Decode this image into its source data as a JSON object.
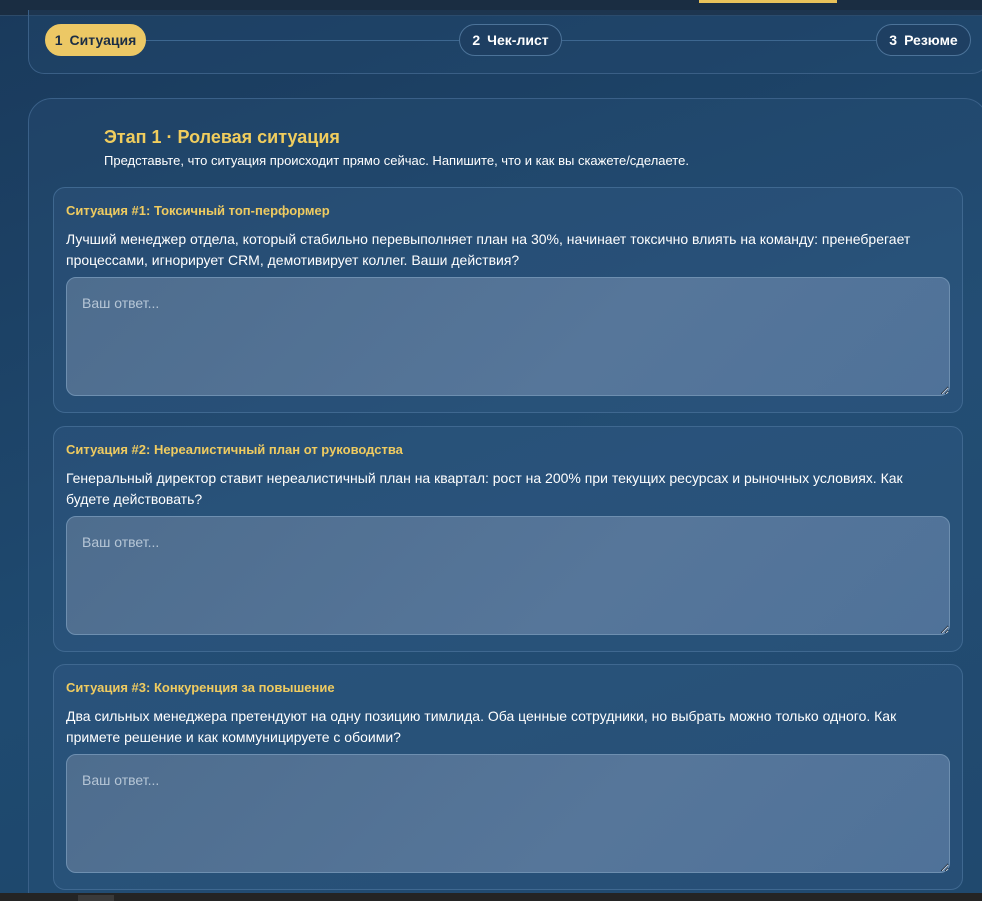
{
  "stepper": {
    "steps": [
      {
        "num": "1",
        "label": "Ситуация",
        "active": true
      },
      {
        "num": "2",
        "label": "Чек-лист",
        "active": false
      },
      {
        "num": "3",
        "label": "Резюме",
        "active": false
      }
    ]
  },
  "stage": {
    "title": "Этап 1 · Ролевая ситуация",
    "subtitle": "Представьте, что ситуация происходит прямо сейчас. Напишите, что и как вы скажете/сделаете."
  },
  "situations": [
    {
      "title": "Ситуация #1: Токсичный топ-перформер",
      "text": "Лучший менеджер отдела, который стабильно перевыполняет план на 30%, начинает токсично влиять на команду: пренебрегает процессами, игнорирует CRM, демотивирует коллег. Ваши действия?",
      "placeholder": "Ваш ответ...",
      "value": ""
    },
    {
      "title": "Ситуация #2: Нереалистичный план от руководства",
      "text": "Генеральный директор ставит нереалистичный план на квартал: рост на 200% при текущих ресурсах и рыночных условиях. Как будете действовать?",
      "placeholder": "Ваш ответ...",
      "value": ""
    },
    {
      "title": "Ситуация #3: Конкуренция за повышение",
      "text": "Два сильных менеджера претендуют на одну позицию тимлида. Оба ценные сотрудники, но выбрать можно только одного. Как примете решение и как коммуницируете с обоими?",
      "placeholder": "Ваш ответ...",
      "value": ""
    }
  ],
  "colors": {
    "accent": "#ecc865",
    "background": "#1c3e61",
    "card_border": "#3a6088"
  }
}
